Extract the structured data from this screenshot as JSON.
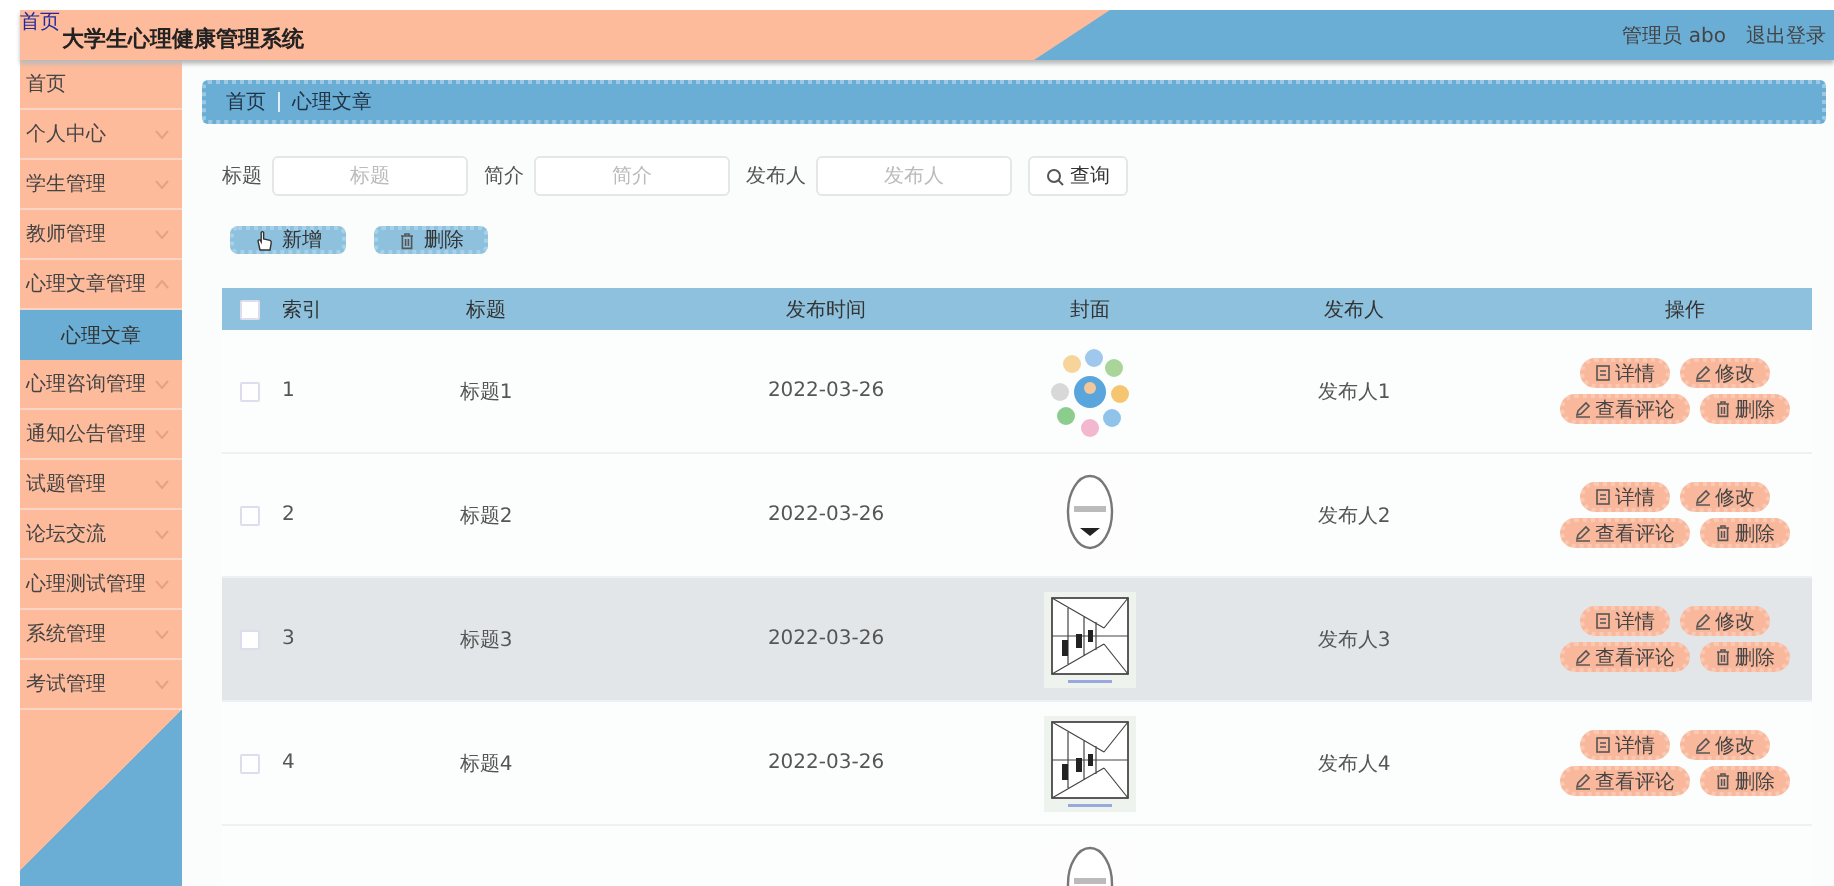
{
  "header": {
    "logo_text": "首页",
    "title": "大学生心理健康管理系统",
    "user": "管理员 abo",
    "logout": "退出登录"
  },
  "sidebar": {
    "items": [
      {
        "label": "首页",
        "kind": "link"
      },
      {
        "label": "个人中心",
        "kind": "menu",
        "expanded": false
      },
      {
        "label": "学生管理",
        "kind": "menu",
        "expanded": false
      },
      {
        "label": "教师管理",
        "kind": "menu",
        "expanded": false
      },
      {
        "label": "心理文章管理",
        "kind": "menu",
        "expanded": true,
        "children": [
          {
            "label": "心理文章",
            "selected": true
          }
        ]
      },
      {
        "label": "心理咨询管理",
        "kind": "menu",
        "expanded": false
      },
      {
        "label": "通知公告管理",
        "kind": "menu",
        "expanded": false
      },
      {
        "label": "试题管理",
        "kind": "menu",
        "expanded": false
      },
      {
        "label": "论坛交流",
        "kind": "menu",
        "expanded": false
      },
      {
        "label": "心理测试管理",
        "kind": "menu",
        "expanded": false
      },
      {
        "label": "系统管理",
        "kind": "menu",
        "expanded": false
      },
      {
        "label": "考试管理",
        "kind": "menu",
        "expanded": false
      }
    ]
  },
  "breadcrumb": [
    "首页",
    "心理文章"
  ],
  "search": {
    "fields": [
      {
        "label": "标题",
        "placeholder": "标题"
      },
      {
        "label": "简介",
        "placeholder": "简介"
      },
      {
        "label": "发布人",
        "placeholder": "发布人"
      }
    ],
    "button": "查询"
  },
  "toolbar": [
    {
      "label": "新增",
      "kind": "add"
    },
    {
      "label": "删除",
      "kind": "delete"
    }
  ],
  "table": {
    "select_all": {
      "checked": false
    },
    "columns": [
      "索引",
      "标题",
      "发布时间",
      "封面",
      "发布人",
      "操作"
    ],
    "rows": [
      {
        "checked": false,
        "highlighted": false,
        "index": "1",
        "title": "标题1",
        "date": "2022-03-26",
        "cover": {
          "kind": "picture"
        },
        "publisher": "发布人1",
        "actions": [
          {
            "label": "详情",
            "kind": "detail"
          },
          {
            "label": "修改",
            "kind": "edit"
          },
          {
            "label": "查看评论",
            "kind": "comments"
          },
          {
            "label": "删除",
            "kind": "delete"
          }
        ]
      },
      {
        "checked": false,
        "highlighted": false,
        "index": "2",
        "title": "标题2",
        "date": "2022-03-26",
        "cover": {
          "kind": "picture"
        },
        "publisher": "发布人2",
        "actions": [
          {
            "label": "详情",
            "kind": "detail"
          },
          {
            "label": "修改",
            "kind": "edit"
          },
          {
            "label": "查看评论",
            "kind": "comments"
          },
          {
            "label": "删除",
            "kind": "delete"
          }
        ]
      },
      {
        "checked": false,
        "highlighted": true,
        "index": "3",
        "title": "标题3",
        "date": "2022-03-26",
        "cover": {
          "kind": "picture"
        },
        "publisher": "发布人3",
        "actions": [
          {
            "label": "详情",
            "kind": "detail"
          },
          {
            "label": "修改",
            "kind": "edit"
          },
          {
            "label": "查看评论",
            "kind": "comments"
          },
          {
            "label": "删除",
            "kind": "delete"
          }
        ]
      },
      {
        "checked": false,
        "highlighted": false,
        "index": "4",
        "title": "标题4",
        "date": "2022-03-26",
        "cover": {
          "kind": "picture"
        },
        "publisher": "发布人4",
        "actions": [
          {
            "label": "详情",
            "kind": "detail"
          },
          {
            "label": "修改",
            "kind": "edit"
          },
          {
            "label": "查看评论",
            "kind": "comments"
          },
          {
            "label": "删除",
            "kind": "delete"
          }
        ]
      },
      {
        "cover": {
          "kind": "picture"
        }
      }
    ]
  }
}
